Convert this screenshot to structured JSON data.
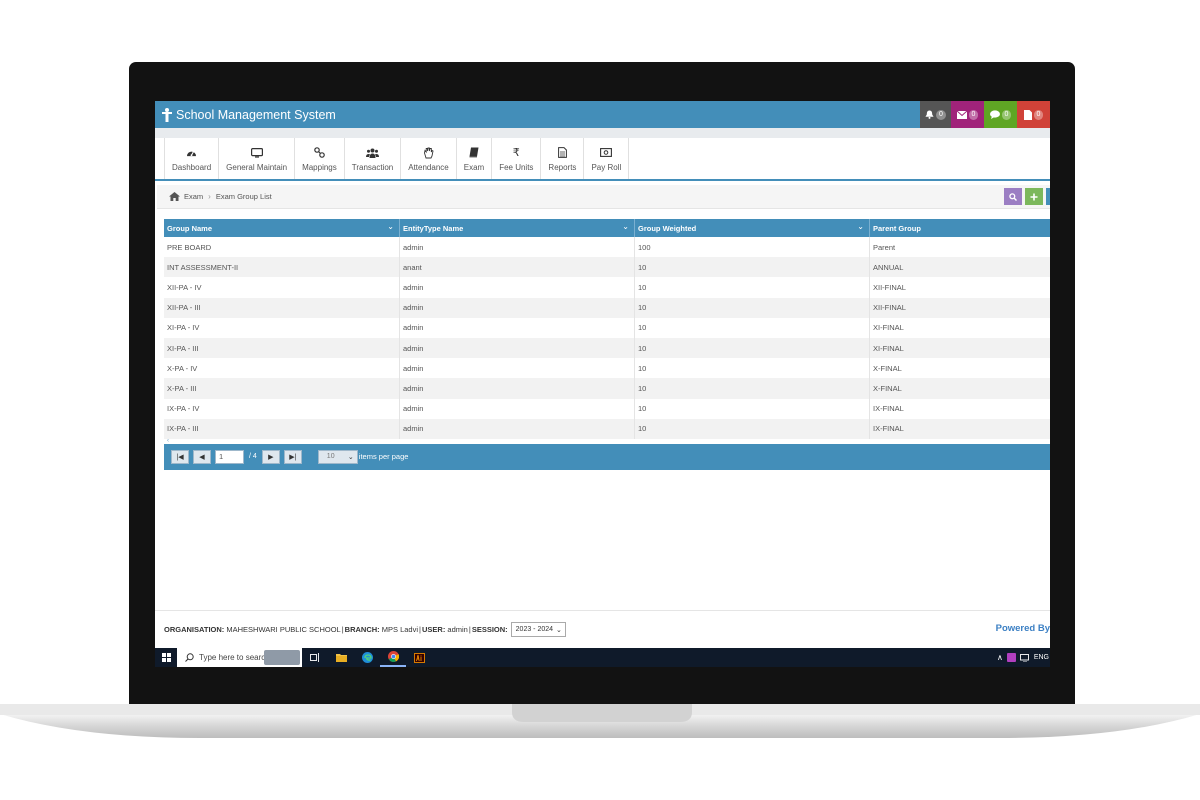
{
  "app": {
    "title": "School Management System",
    "accent_color": "#438eb9",
    "header_badges": [
      {
        "icon": "bell-icon",
        "count": "0",
        "color": "#555555"
      },
      {
        "icon": "envelope-icon",
        "count": "0",
        "color": "#a0237a"
      },
      {
        "icon": "chat-icon",
        "count": "0",
        "color": "#5fa624"
      },
      {
        "icon": "document-icon",
        "count": "0",
        "color": "#d04238"
      }
    ]
  },
  "nav": {
    "items": [
      {
        "label": "Dashboard",
        "icon": "dashboard-icon"
      },
      {
        "label": "General Maintain",
        "icon": "monitor-icon"
      },
      {
        "label": "Mappings",
        "icon": "link-icon"
      },
      {
        "label": "Transaction",
        "icon": "users-icon"
      },
      {
        "label": "Attendance",
        "icon": "hand-icon"
      },
      {
        "label": "Exam",
        "icon": "book-icon"
      },
      {
        "label": "Fee Units",
        "icon": "rupee-icon"
      },
      {
        "label": "Reports",
        "icon": "report-icon"
      },
      {
        "label": "Pay Roll",
        "icon": "money-icon"
      }
    ]
  },
  "breadcrumb": {
    "home_icon": "home-icon",
    "items": [
      "Exam",
      "Exam Group List"
    ]
  },
  "grid": {
    "columns": [
      "Group Name",
      "EntityType Name",
      "Group Weighted",
      "Parent Group"
    ],
    "rows": [
      [
        "PRE BOARD",
        "admin",
        "100",
        "Parent"
      ],
      [
        "INT ASSESSMENT-II",
        "anant",
        "10",
        "ANNUAL"
      ],
      [
        "XII-PA - IV",
        "admin",
        "10",
        "XII-FINAL"
      ],
      [
        "XII-PA - III",
        "admin",
        "10",
        "XII-FINAL"
      ],
      [
        "XI-PA - IV",
        "admin",
        "10",
        "XI-FINAL"
      ],
      [
        "XI-PA - III",
        "admin",
        "10",
        "XI-FINAL"
      ],
      [
        "X-PA - IV",
        "admin",
        "10",
        "X-FINAL"
      ],
      [
        "X-PA - III",
        "admin",
        "10",
        "X-FINAL"
      ],
      [
        "IX-PA - IV",
        "admin",
        "10",
        "IX-FINAL"
      ],
      [
        "IX-PA - III",
        "admin",
        "10",
        "IX-FINAL"
      ]
    ]
  },
  "pager": {
    "current_page": "1",
    "total_pages": "/ 4",
    "page_size": "10",
    "items_label": "items per page"
  },
  "footer": {
    "organisation_label": "ORGANISATION:",
    "organisation_value": "MAHESHWARI PUBLIC SCHOOL",
    "branch_label": "BRANCH:",
    "branch_value": "MPS Ladvi",
    "user_label": "USER:",
    "user_value": "admin",
    "session_label": "SESSION:",
    "session_value": "2023 - 2024",
    "powered_by": "Powered By"
  },
  "taskbar": {
    "search_placeholder": "Type here to search",
    "tray_lang": "ENG"
  }
}
